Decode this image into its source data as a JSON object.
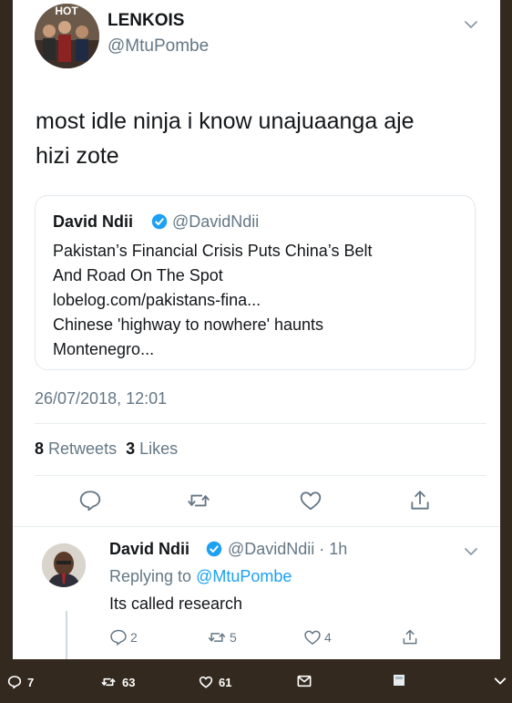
{
  "tweet": {
    "author_name": "LENKOIS",
    "author_handle": "@MtuPombe",
    "avatar_caption": "HOT",
    "text_line1": "most idle ninja i know unajuaanga aje",
    "text_line2": "hizi zote",
    "quote": {
      "author_name": "David Ndii",
      "author_handle": "@DavidNdii",
      "lines": [
        "Pakistan’s Financial Crisis Puts China’s Belt",
        "And Road On The Spot",
        "lobelog.com/pakistans-fina...",
        "Chinese 'highway to nowhere' haunts",
        "Montenegro..."
      ]
    },
    "timestamp": "26/07/2018, 12:01",
    "retweets_count": "8",
    "retweets_label": "Retweets",
    "likes_count": "3",
    "likes_label": "Likes"
  },
  "reply": {
    "author_name": "David Ndii",
    "author_handle": "@DavidNdii · 1h",
    "replying_to_label": "Replying to",
    "replying_to_handle": "@MtuPombe",
    "text": "Its called research",
    "reply_count": "2",
    "retweet_count": "5",
    "like_count": "4"
  },
  "bottom_bar": {
    "replies": "7",
    "retweets": "63",
    "likes": "61"
  },
  "colors": {
    "accent": "#1da1f2",
    "secondary_text": "#657786",
    "frame": "#33291f"
  },
  "icons": [
    "chevron-down-icon",
    "verified-icon",
    "reply-icon",
    "retweet-icon",
    "like-icon",
    "share-icon",
    "mail-icon",
    "bookmark-icon"
  ]
}
